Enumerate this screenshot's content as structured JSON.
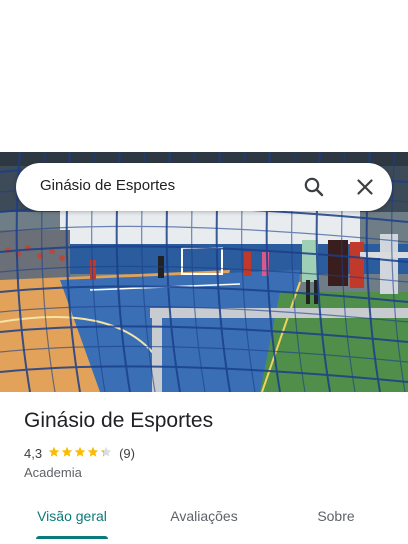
{
  "search": {
    "query": "Ginásio de Esportes"
  },
  "place": {
    "title": "Ginásio de Esportes",
    "rating_value": "4,3",
    "rating_stars": 4.3,
    "review_count": "(9)",
    "category": "Academia"
  },
  "tabs": [
    {
      "label": "Visão geral",
      "active": true
    },
    {
      "label": "Avaliações",
      "active": false
    },
    {
      "label": "Sobre",
      "active": false
    }
  ],
  "colors": {
    "accent": "#0b7a7a",
    "star": "#fbbc04",
    "text": "#202124"
  },
  "icons": {
    "search": "search-icon",
    "close": "close-icon",
    "star": "star-icon"
  }
}
